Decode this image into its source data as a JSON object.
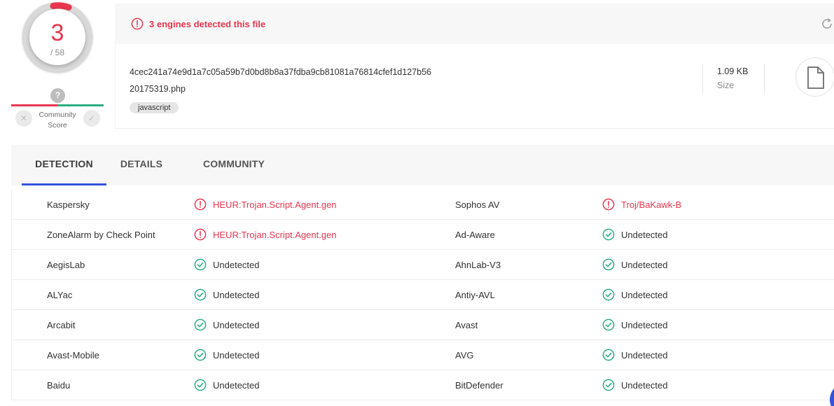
{
  "score": {
    "detected": "3",
    "total": "/ 58"
  },
  "community": {
    "label": "Community Score",
    "unknown_mark": "?"
  },
  "banner": {
    "message": "3 engines detected this file"
  },
  "file": {
    "hash": "4cec241a74e9d1a7c05a59b7d0bd8b8a37fdba9cb81081a76814cfef1d127b56",
    "name": "20175319.php",
    "tag": "javascript",
    "size_value": "1.09 KB",
    "size_label": "Size"
  },
  "tabs": [
    {
      "label": "DETECTION",
      "active": true
    },
    {
      "label": "DETAILS",
      "active": false
    },
    {
      "label": "COMMUNITY",
      "active": false
    }
  ],
  "detections": [
    {
      "left": {
        "engine": "Kaspersky",
        "result": "HEUR:Trojan.Script.Agent.gen",
        "status": "malicious"
      },
      "right": {
        "engine": "Sophos AV",
        "result": "Troj/BaKawk-B",
        "status": "malicious"
      }
    },
    {
      "left": {
        "engine": "ZoneAlarm by Check Point",
        "result": "HEUR:Trojan.Script.Agent.gen",
        "status": "malicious"
      },
      "right": {
        "engine": "Ad-Aware",
        "result": "Undetected",
        "status": "clean"
      }
    },
    {
      "left": {
        "engine": "AegisLab",
        "result": "Undetected",
        "status": "clean"
      },
      "right": {
        "engine": "AhnLab-V3",
        "result": "Undetected",
        "status": "clean"
      }
    },
    {
      "left": {
        "engine": "ALYac",
        "result": "Undetected",
        "status": "clean"
      },
      "right": {
        "engine": "Antiy-AVL",
        "result": "Undetected",
        "status": "clean"
      }
    },
    {
      "left": {
        "engine": "Arcabit",
        "result": "Undetected",
        "status": "clean"
      },
      "right": {
        "engine": "Avast",
        "result": "Undetected",
        "status": "clean"
      }
    },
    {
      "left": {
        "engine": "Avast-Mobile",
        "result": "Undetected",
        "status": "clean"
      },
      "right": {
        "engine": "AVG",
        "result": "Undetected",
        "status": "clean"
      }
    },
    {
      "left": {
        "engine": "Baidu",
        "result": "Undetected",
        "status": "clean"
      },
      "right": {
        "engine": "BitDefender",
        "result": "Undetected",
        "status": "clean"
      }
    }
  ],
  "colors": {
    "malicious": "#e8364f",
    "clean": "#2cac82",
    "accent": "#3452d8"
  },
  "icons": {
    "malicious": "alert-circle-icon",
    "clean": "check-circle-icon",
    "reload": "refresh-icon",
    "file": "file-icon"
  }
}
